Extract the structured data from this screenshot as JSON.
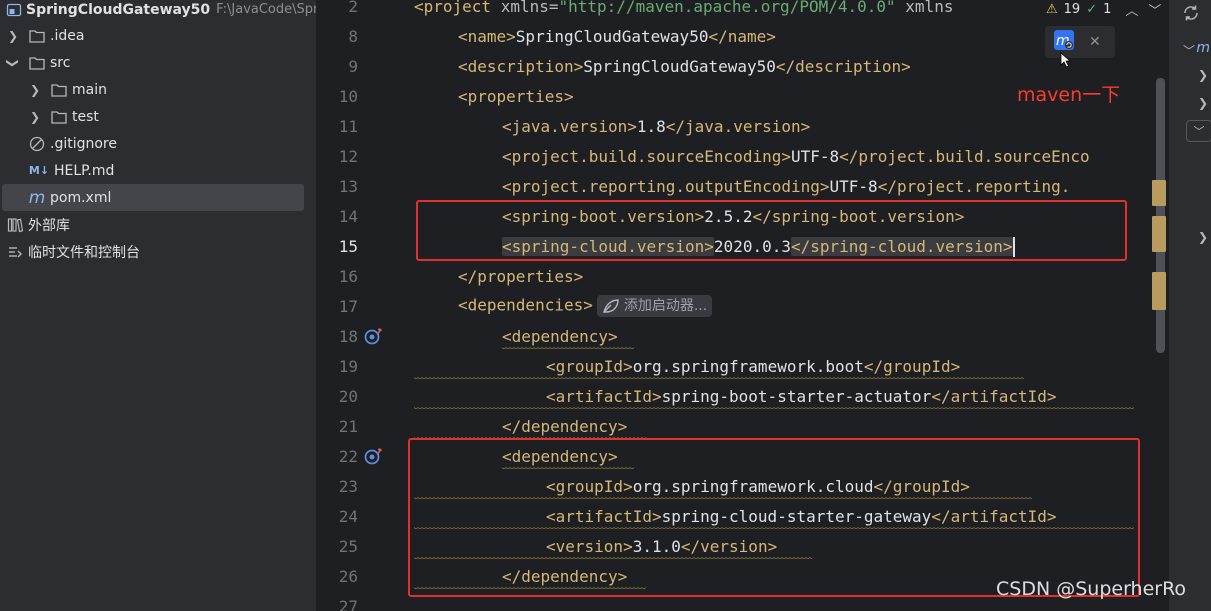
{
  "project": {
    "root_name": "SpringCloudGateway50",
    "root_path": "F:\\JavaCode\\Spring",
    "items": [
      {
        "label": ".idea",
        "icon": "folder-icon"
      },
      {
        "label": "src",
        "icon": "folder-icon"
      },
      {
        "label": "main",
        "icon": "folder-icon"
      },
      {
        "label": "test",
        "icon": "folder-icon"
      },
      {
        "label": ".gitignore",
        "icon": "gitignore-icon"
      },
      {
        "label": "HELP.md",
        "icon": "markdown-icon",
        "icon_text": "M↓"
      },
      {
        "label": "pom.xml",
        "icon": "maven-file-icon",
        "icon_text": "m"
      },
      {
        "label": "外部库",
        "icon": "library-icon"
      },
      {
        "label": "临时文件和控制台",
        "icon": "scratches-icon"
      }
    ]
  },
  "editor": {
    "line_numbers": [
      "2",
      "8",
      "9",
      "10",
      "11",
      "12",
      "13",
      "14",
      "15",
      "16",
      "17",
      "18",
      "19",
      "20",
      "21",
      "22",
      "23",
      "24",
      "25",
      "26",
      "27"
    ],
    "current_line": "15",
    "lines": {
      "l2": {
        "tag_open": "<project ",
        "attr1": "xmlns=",
        "val1": "\"http://maven.apache.org/POM/4.0.0\"",
        "attr2": " xmlns"
      },
      "l8": {
        "open": "<name>",
        "text": "SpringCloudGateway50",
        "close": "</name>"
      },
      "l9": {
        "open": "<description>",
        "text": "SpringCloudGateway50",
        "close": "</description>"
      },
      "l10": {
        "open": "<properties>"
      },
      "l11": {
        "open": "<java.version>",
        "text": "1.8",
        "close": "</java.version>"
      },
      "l12": {
        "open": "<project.build.sourceEncoding>",
        "text": "UTF-8",
        "close": "</project.build.sourceEnco"
      },
      "l13": {
        "open": "<project.reporting.outputEncoding>",
        "text": "UTF-8",
        "close": "</project.reporting."
      },
      "l14": {
        "open": "<spring-boot.version>",
        "text": "2.5.2",
        "close": "</spring-boot.version>"
      },
      "l15": {
        "open": "<spring-cloud.version>",
        "text": "2020.0.3",
        "close": "</spring-cloud.version>"
      },
      "l16": {
        "close": "</properties>"
      },
      "l17": {
        "open": "<dependencies>",
        "hint": "添加启动器..."
      },
      "l18": {
        "open": "<dependency>"
      },
      "l19": {
        "open": "<groupId>",
        "text": "org.springframework.boot",
        "close": "</groupId>"
      },
      "l20": {
        "open": "<artifactId>",
        "text": "spring-boot-starter-actuator",
        "close": "</artifactId>"
      },
      "l21": {
        "close": "</dependency>"
      },
      "l22": {
        "open": "<dependency>"
      },
      "l23": {
        "open": "<groupId>",
        "text": "org.springframework.cloud",
        "close": "</groupId>"
      },
      "l24": {
        "open": "<artifactId>",
        "text": "spring-cloud-starter-gateway",
        "close": "</artifactId>"
      },
      "l25": {
        "open": "<version>",
        "text": "3.1.0",
        "close": "</version>"
      },
      "l26": {
        "close": "</dependency>"
      }
    }
  },
  "inspections": {
    "warnings": "19",
    "ok": "1"
  },
  "annotation": {
    "note": "maven一下"
  },
  "watermark": "CSDN @SuperherRo",
  "colors": {
    "tag": "#d5b778",
    "text": "#dfe1e5",
    "annotation": "#e0312b",
    "warning": "#f2c55c"
  }
}
